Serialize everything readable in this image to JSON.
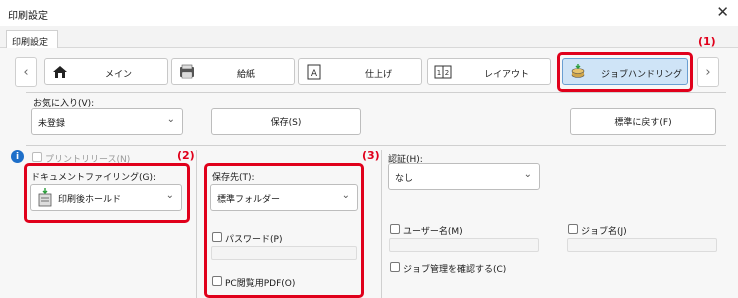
{
  "window": {
    "title": "印刷設定",
    "close_symbol": "✕"
  },
  "tabs": [
    {
      "label": "印刷設定"
    }
  ],
  "categories": {
    "prev_symbol": "‹",
    "next_symbol": "›",
    "items": [
      {
        "label": "メイン",
        "icon": "home-icon"
      },
      {
        "label": "給紙",
        "icon": "printer-paper-icon"
      },
      {
        "label": "仕上げ",
        "icon": "finishing-icon"
      },
      {
        "label": "レイアウト",
        "icon": "layout-icon"
      },
      {
        "label": "ジョブハンドリング",
        "icon": "job-handling-icon",
        "active": true
      }
    ]
  },
  "favorites": {
    "label": "お気に入り(V):",
    "value": "未登録",
    "save_button": "保存(S)",
    "reset_button": "標準に戻す(F)"
  },
  "print_release": {
    "label": "プリントリリース(N)",
    "checked": false,
    "enabled": false
  },
  "document_filing": {
    "label": "ドキュメントファイリング(G):",
    "value": "印刷後ホールド"
  },
  "save_destination": {
    "label": "保存先(T):",
    "value": "標準フォルダー",
    "password_label": "パスワード(P)",
    "password_value": "",
    "pdf_label": "PC閲覧用PDF(O)"
  },
  "authentication": {
    "label": "認証(H):",
    "value": "なし",
    "username_label": "ユーザー名(M)",
    "username_value": "",
    "jobname_label": "ジョブ名(J)",
    "jobname_value": "",
    "confirm_label": "ジョブ管理を確認する(C)"
  },
  "callouts": {
    "c1": "(1)",
    "c2": "(2)",
    "c3": "(3)"
  },
  "colors": {
    "accent_red": "#e0001b",
    "active_tab": "#cfe4f7",
    "info_blue": "#1e6fc9"
  }
}
